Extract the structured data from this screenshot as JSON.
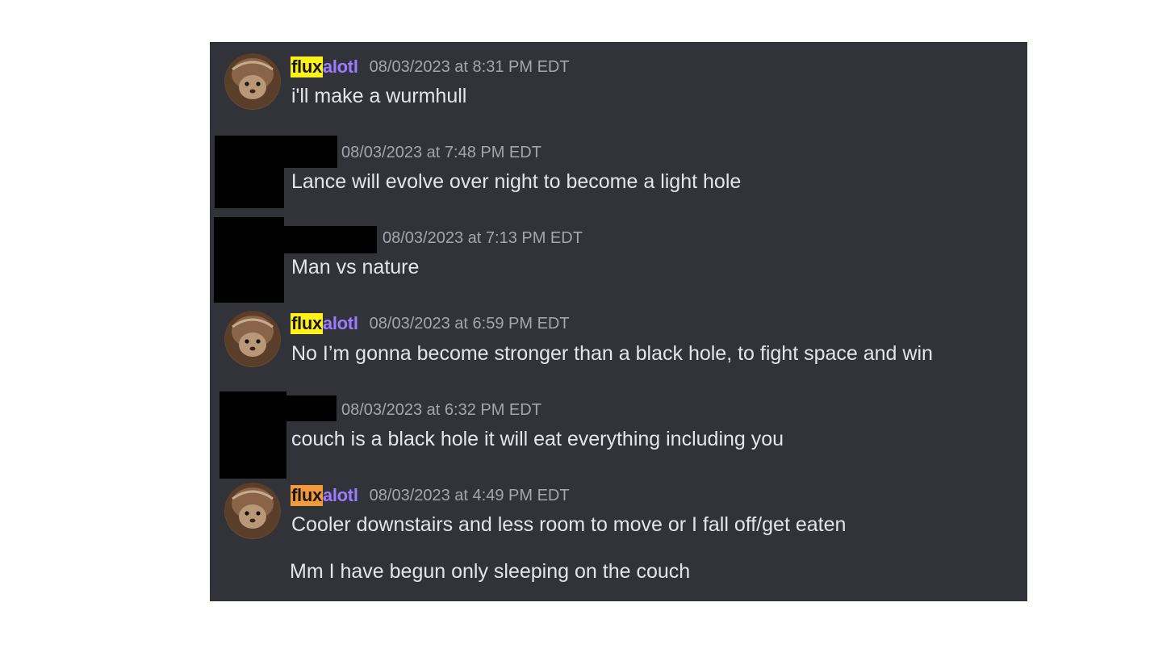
{
  "colors": {
    "panel_bg": "#313338",
    "text": "#e3e5e8",
    "timestamp": "#a3a6ad",
    "username_purple": "#9b7cff",
    "highlight_yellow": "#fff21a",
    "highlight_orange": "#f59a3a",
    "redaction": "#000000"
  },
  "messages": [
    {
      "author_prefix": "flux",
      "author_suffix": "alotl",
      "timestamp": "08/03/2023 at 8:31 PM EDT",
      "text": "i'll make a wurmhull"
    },
    {
      "author_redacted": true,
      "timestamp": "08/03/2023 at 7:48 PM EDT",
      "text": "Lance will evolve over night to become a light hole"
    },
    {
      "author_redacted": true,
      "timestamp": "08/03/2023 at 7:13 PM EDT",
      "text": "Man vs nature"
    },
    {
      "author_prefix": "flux",
      "author_suffix": "alotl",
      "timestamp": "08/03/2023 at 6:59 PM EDT",
      "text": "No I’m gonna become stronger than a black hole, to fight space and win"
    },
    {
      "author_redacted": true,
      "timestamp": "08/03/2023 at 6:32 PM EDT",
      "text": "couch is a black hole it will eat everything including you"
    },
    {
      "author_prefix": "flux",
      "author_suffix": "alotl",
      "timestamp": "08/03/2023 at 4:49 PM EDT",
      "text": "Cooler downstairs and less room to move or I fall off/get eaten",
      "followup": "Mm I have begun only sleeping on the couch"
    }
  ]
}
